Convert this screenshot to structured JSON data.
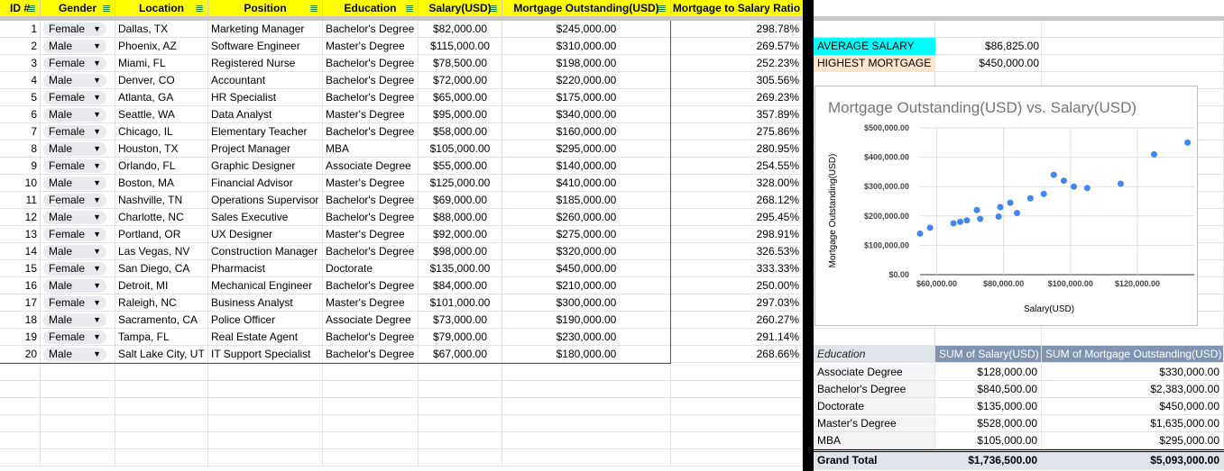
{
  "headers": [
    "ID #",
    "Gender",
    "Location",
    "Position",
    "Education",
    "Salary(USD)",
    "Mortgage Outstanding(USD)",
    "Mortgage to Salary Ratio"
  ],
  "rows": [
    [
      "1",
      "Female",
      "Dallas, TX",
      "Marketing Manager",
      "Bachelor's Degree",
      "$82,000.00",
      "$245,000.00",
      "298.78%"
    ],
    [
      "2",
      "Male",
      "Phoenix, AZ",
      "Software Engineer",
      "Master's Degree",
      "$115,000.00",
      "$310,000.00",
      "269.57%"
    ],
    [
      "3",
      "Female",
      "Miami, FL",
      "Registered Nurse",
      "Bachelor's Degree",
      "$78,500.00",
      "$198,000.00",
      "252.23%"
    ],
    [
      "4",
      "Male",
      "Denver, CO",
      "Accountant",
      "Bachelor's Degree",
      "$72,000.00",
      "$220,000.00",
      "305.56%"
    ],
    [
      "5",
      "Female",
      "Atlanta, GA",
      "HR Specialist",
      "Bachelor's Degree",
      "$65,000.00",
      "$175,000.00",
      "269.23%"
    ],
    [
      "6",
      "Male",
      "Seattle, WA",
      "Data Analyst",
      "Master's Degree",
      "$95,000.00",
      "$340,000.00",
      "357.89%"
    ],
    [
      "7",
      "Female",
      "Chicago, IL",
      "Elementary Teacher",
      "Bachelor's Degree",
      "$58,000.00",
      "$160,000.00",
      "275.86%"
    ],
    [
      "8",
      "Male",
      "Houston, TX",
      "Project Manager",
      "MBA",
      "$105,000.00",
      "$295,000.00",
      "280.95%"
    ],
    [
      "9",
      "Female",
      "Orlando, FL",
      "Graphic Designer",
      "Associate Degree",
      "$55,000.00",
      "$140,000.00",
      "254.55%"
    ],
    [
      "10",
      "Male",
      "Boston, MA",
      "Financial Advisor",
      "Master's Degree",
      "$125,000.00",
      "$410,000.00",
      "328.00%"
    ],
    [
      "11",
      "Female",
      "Nashville, TN",
      "Operations Supervisor",
      "Bachelor's Degree",
      "$69,000.00",
      "$185,000.00",
      "268.12%"
    ],
    [
      "12",
      "Male",
      "Charlotte, NC",
      "Sales Executive",
      "Bachelor's Degree",
      "$88,000.00",
      "$260,000.00",
      "295.45%"
    ],
    [
      "13",
      "Female",
      "Portland, OR",
      "UX Designer",
      "Master's Degree",
      "$92,000.00",
      "$275,000.00",
      "298.91%"
    ],
    [
      "14",
      "Male",
      "Las Vegas, NV",
      "Construction Manager",
      "Bachelor's Degree",
      "$98,000.00",
      "$320,000.00",
      "326.53%"
    ],
    [
      "15",
      "Female",
      "San Diego, CA",
      "Pharmacist",
      "Doctorate",
      "$135,000.00",
      "$450,000.00",
      "333.33%"
    ],
    [
      "16",
      "Male",
      "Detroit, MI",
      "Mechanical Engineer",
      "Bachelor's Degree",
      "$84,000.00",
      "$210,000.00",
      "250.00%"
    ],
    [
      "17",
      "Female",
      "Raleigh, NC",
      "Business Analyst",
      "Master's Degree",
      "$101,000.00",
      "$300,000.00",
      "297.03%"
    ],
    [
      "18",
      "Male",
      "Sacramento, CA",
      "Police Officer",
      "Associate Degree",
      "$73,000.00",
      "$190,000.00",
      "260.27%"
    ],
    [
      "19",
      "Female",
      "Tampa, FL",
      "Real Estate Agent",
      "Bachelor's Degree",
      "$79,000.00",
      "$230,000.00",
      "291.14%"
    ],
    [
      "20",
      "Male",
      "Salt Lake City, UT",
      "IT Support Specialist",
      "Bachelor's Degree",
      "$67,000.00",
      "$180,000.00",
      "268.66%"
    ]
  ],
  "summary": {
    "avg_label": "AVERAGE SALARY",
    "avg_value": "$86,825.00",
    "max_label": "HIGHEST MORTGAGE",
    "max_value": "$450,000.00",
    "avg_color": "#00ffff",
    "max_color": "#fce5cd"
  },
  "pivot": {
    "headers": [
      "Education",
      "SUM of Salary(USD)",
      "SUM of Mortgage Outstanding(USD)"
    ],
    "rows": [
      [
        "Associate Degree",
        "$128,000.00",
        "$330,000.00"
      ],
      [
        "Bachelor's Degree",
        "$840,500.00",
        "$2,383,000.00"
      ],
      [
        "Doctorate",
        "$135,000.00",
        "$450,000.00"
      ],
      [
        "Master's Degree",
        "$528,000.00",
        "$1,635,000.00"
      ],
      [
        "MBA",
        "$105,000.00",
        "$295,000.00"
      ]
    ],
    "total": [
      "Grand Total",
      "$1,736,500.00",
      "$5,093,000.00"
    ]
  },
  "chart_data": {
    "type": "scatter",
    "title": "Mortgage Outstanding(USD) vs. Salary(USD)",
    "xlabel": "Salary(USD)",
    "ylabel": "Mortgage Outstanding(USD)",
    "xlim": [
      55000,
      137000
    ],
    "ylim": [
      0,
      500000
    ],
    "xticks": [
      60000,
      80000,
      100000,
      120000
    ],
    "xtick_labels": [
      "$60,000.00",
      "$80,000.00",
      "$100,000.00",
      "$120,000.00"
    ],
    "yticks": [
      0,
      100000,
      200000,
      300000,
      400000,
      500000
    ],
    "ytick_labels": [
      "$0.00",
      "$100,000.00",
      "$200,000.00",
      "$300,000.00",
      "$400,000.00",
      "$500,000.00"
    ],
    "x": [
      82000,
      115000,
      78500,
      72000,
      65000,
      95000,
      58000,
      105000,
      55000,
      125000,
      69000,
      88000,
      92000,
      98000,
      135000,
      84000,
      101000,
      73000,
      79000,
      67000
    ],
    "y": [
      245000,
      310000,
      198000,
      220000,
      175000,
      340000,
      160000,
      295000,
      140000,
      410000,
      185000,
      260000,
      275000,
      320000,
      450000,
      210000,
      300000,
      190000,
      230000,
      180000
    ],
    "color": "#4285f4",
    "grid": true
  }
}
